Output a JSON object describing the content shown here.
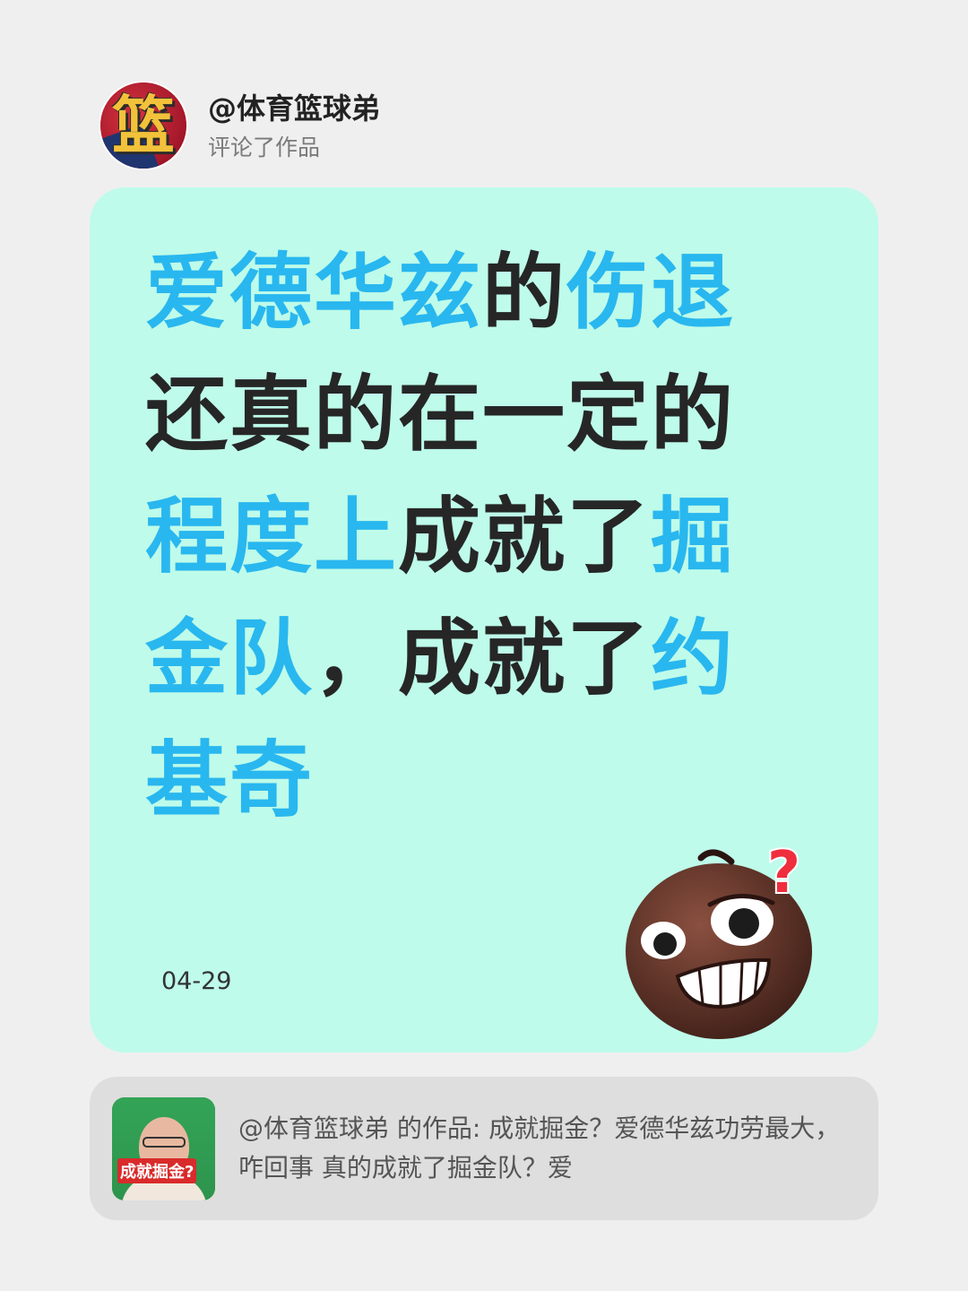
{
  "header": {
    "username": "@体育篮球弟",
    "action": "评论了作品",
    "avatar_glyph": "篮"
  },
  "comment": {
    "lines": [
      [
        {
          "text": "爱德华兹",
          "hl": true
        },
        {
          "text": "的",
          "hl": false
        },
        {
          "text": "伤退",
          "hl": true
        }
      ],
      [
        {
          "text": "还真的在一定的",
          "hl": false
        }
      ],
      [
        {
          "text": "程度上",
          "hl": true
        },
        {
          "text": "成就了",
          "hl": false
        },
        {
          "text": "掘",
          "hl": true
        }
      ],
      [
        {
          "text": "金队",
          "hl": true
        },
        {
          "text": "，成就了",
          "hl": false
        },
        {
          "text": "约",
          "hl": true
        }
      ],
      [
        {
          "text": "基奇",
          "hl": true
        }
      ]
    ],
    "date": "04-29",
    "emoji": "smirk-face-question-icon",
    "colors": {
      "card_bg": "#befbea",
      "highlight": "#29b7ef",
      "text": "#262626"
    }
  },
  "reference": {
    "thumbnail_caption": "成就掘金?",
    "text": "@体育篮球弟 的作品: 成就掘金？爱德华兹功劳最大，咋回事 真的成就了掘金队？爱"
  }
}
